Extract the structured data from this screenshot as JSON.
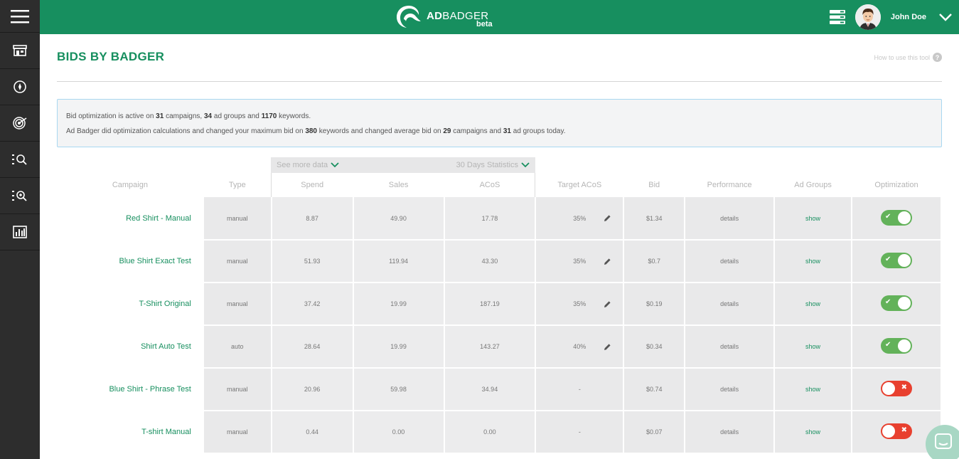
{
  "app": {
    "logo_main_bold": "AD",
    "logo_main_rest": "BADGER",
    "logo_beta": "beta",
    "brand_color": "#178f5f"
  },
  "user": {
    "name": "John Doe"
  },
  "sidebar": {
    "items": [
      {
        "icon": "hamburger-menu-icon"
      },
      {
        "icon": "store-icon"
      },
      {
        "icon": "compass-icon"
      },
      {
        "icon": "target-icon"
      },
      {
        "icon": "list-search-icon"
      },
      {
        "icon": "list-zoom-icon"
      },
      {
        "icon": "bar-chart-icon"
      }
    ]
  },
  "page": {
    "title": "BIDS BY BADGER",
    "help_text": "How to use this tool"
  },
  "info": {
    "line1": {
      "t1": "Bid optimization is active on ",
      "v1": "31",
      "t2": " campaigns, ",
      "v2": "34",
      "t3": " ad groups and ",
      "v3": "1170",
      "t4": " keywords."
    },
    "line2": {
      "t1": "Ad Badger did optimization calculations and changed your maximum bid on ",
      "v1": "380",
      "t2": " keywords and changed average bid on ",
      "v2": "29",
      "t3": " campaigns and ",
      "v3": "31",
      "t4": " ad groups today."
    }
  },
  "stats_bar": {
    "see_more": "See more data",
    "period": "30 Days Statistics"
  },
  "table": {
    "headers": {
      "campaign": "Campaign",
      "type": "Type",
      "spend": "Spend",
      "sales": "Sales",
      "acos": "ACoS",
      "target_acos": "Target ACoS",
      "bid": "Bid",
      "performance": "Performance",
      "ad_groups": "Ad Groups",
      "optimization": "Optimization"
    },
    "rows": [
      {
        "campaign": "Red Shirt - Manual",
        "type": "manual",
        "spend": "8.87",
        "sales": "49.90",
        "acos": "17.78",
        "target": "35%",
        "bid": "$1.34",
        "perf": "details",
        "groups": "show",
        "opt": "on"
      },
      {
        "campaign": "Blue Shirt Exact Test",
        "type": "manual",
        "spend": "51.93",
        "sales": "119.94",
        "acos": "43.30",
        "target": "35%",
        "bid": "$0.7",
        "perf": "details",
        "groups": "show",
        "opt": "on"
      },
      {
        "campaign": "T-Shirt Original",
        "type": "manual",
        "spend": "37.42",
        "sales": "19.99",
        "acos": "187.19",
        "target": "35%",
        "bid": "$0.19",
        "perf": "details",
        "groups": "show",
        "opt": "on"
      },
      {
        "campaign": "Shirt Auto Test",
        "type": "auto",
        "spend": "28.64",
        "sales": "19.99",
        "acos": "143.27",
        "target": "40%",
        "bid": "$0.34",
        "perf": "details",
        "groups": "show",
        "opt": "on"
      },
      {
        "campaign": "Blue Shirt - Phrase Test",
        "type": "manual",
        "spend": "20.96",
        "sales": "59.98",
        "acos": "34.94",
        "target": "-",
        "bid": "$0.74",
        "perf": "details",
        "groups": "show",
        "opt": "off"
      },
      {
        "campaign": "T-shirt Manual",
        "type": "manual",
        "spend": "0.44",
        "sales": "0.00",
        "acos": "0.00",
        "target": "-",
        "bid": "$0.07",
        "perf": "details",
        "groups": "show",
        "opt": "off"
      }
    ]
  },
  "colors": {
    "toggle_on": "#63b25a",
    "toggle_off": "#e8402f"
  }
}
